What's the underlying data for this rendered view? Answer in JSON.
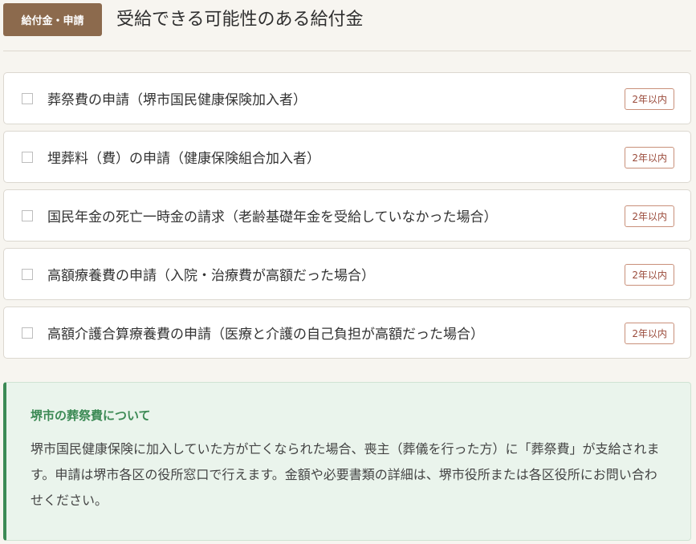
{
  "header": {
    "badge": "給付金・申請",
    "title": "受給できる可能性のある給付金"
  },
  "items": [
    {
      "label": "葬祭費の申請（堺市国民健康保険加入者）",
      "deadline": "2年以内"
    },
    {
      "label": "埋葬料（費）の申請（健康保険組合加入者）",
      "deadline": "2年以内"
    },
    {
      "label": "国民年金の死亡一時金の請求（老齢基礎年金を受給していなかった場合）",
      "deadline": "2年以内"
    },
    {
      "label": "高額療養費の申請（入院・治療費が高額だった場合）",
      "deadline": "2年以内"
    },
    {
      "label": "高額介護合算療養費の申請（医療と介護の自己負担が高額だった場合）",
      "deadline": "2年以内"
    }
  ],
  "info": {
    "title": "堺市の葬祭費について",
    "body": "堺市国民健康保険に加入していた方が亡くなられた場合、喪主（葬儀を行った方）に「葬祭費」が支給されます。申請は堺市各区の役所窓口で行えます。金額や必要書類の詳細は、堺市役所または各区役所にお問い合わせください。"
  }
}
